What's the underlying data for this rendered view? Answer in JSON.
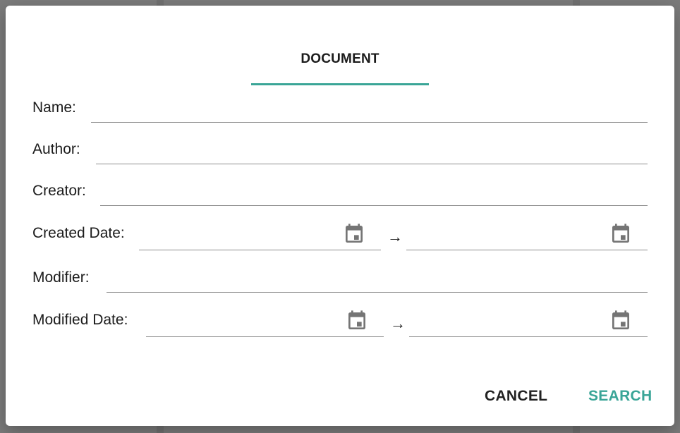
{
  "dialog": {
    "tab": {
      "label": "DOCUMENT"
    },
    "fields": {
      "name": {
        "label": "Name:",
        "value": ""
      },
      "author": {
        "label": "Author:",
        "value": ""
      },
      "creator": {
        "label": "Creator:",
        "value": ""
      },
      "created_date": {
        "label": "Created Date:",
        "from": "",
        "to": "",
        "separator": "→"
      },
      "modifier": {
        "label": "Modifier:",
        "value": ""
      },
      "modified_date": {
        "label": "Modified Date:",
        "from": "",
        "to": "",
        "separator": "→"
      }
    },
    "actions": {
      "cancel": "CANCEL",
      "search": "SEARCH"
    }
  },
  "background": {
    "peek_text": "t"
  },
  "colors": {
    "accent": "#3aa597",
    "scrim": "#7b7b7b",
    "underline": "#8d8d8d"
  },
  "icons": {
    "calendar": "calendar-icon"
  }
}
